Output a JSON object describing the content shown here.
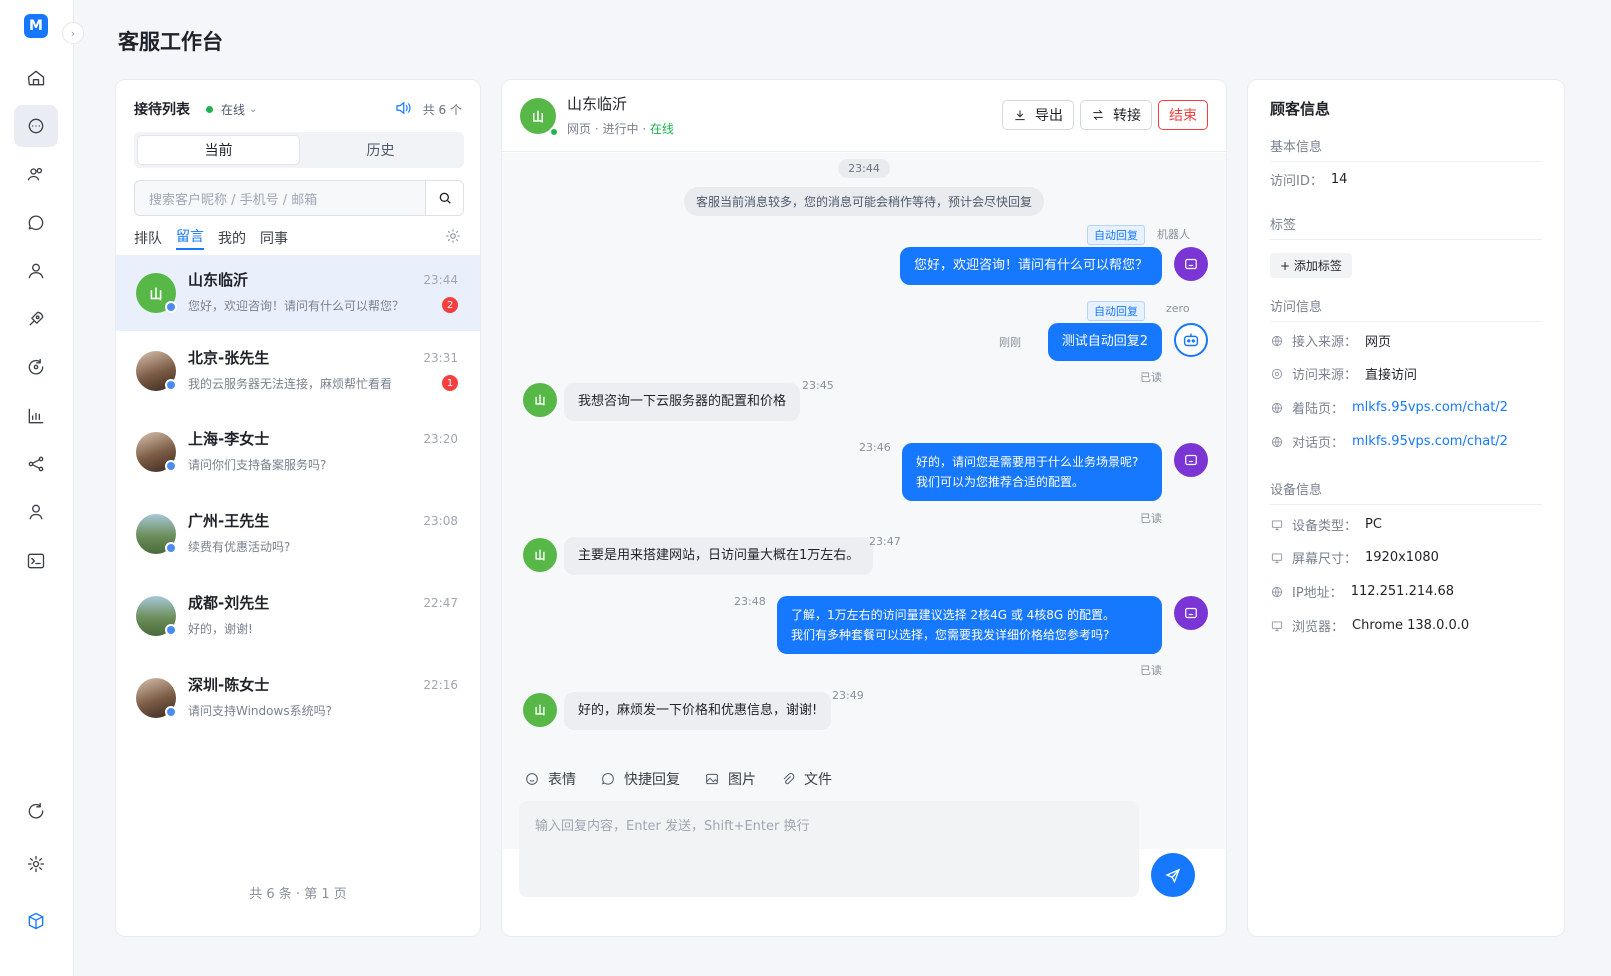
{
  "page_title": "客服工作台",
  "rail": {
    "logo": "M",
    "items": [
      "home-icon",
      "chat-icon",
      "users-icon",
      "message-icon",
      "user-icon",
      "rocket-icon",
      "sync-icon",
      "chart-icon",
      "share-icon",
      "person-icon",
      "terminal-icon",
      "refresh-icon",
      "settings-icon",
      "box-icon"
    ]
  },
  "list": {
    "title": "接待列表",
    "status": "在线",
    "count": "共 6 个",
    "tabs": [
      "当前",
      "历史"
    ],
    "search_placeholder": "搜索客户昵称 / 手机号 / 邮箱",
    "filters": [
      "排队",
      "留言",
      "我的",
      "同事"
    ],
    "conversations": [
      {
        "name": "山东临沂",
        "time": "23:44",
        "message": "您好，欢迎咨询！请问有什么可以帮您？",
        "unread": "2",
        "avatar": "山"
      },
      {
        "name": "北京-张先生",
        "time": "23:31",
        "message": "我的云服务器无法连接，麻烦帮忙看看",
        "unread": "1",
        "avatar": ""
      },
      {
        "name": "上海-李女士",
        "time": "23:20",
        "message": "请问你们支持备案服务吗?",
        "unread": "",
        "avatar": ""
      },
      {
        "name": "广州-王先生",
        "time": "23:08",
        "message": "续费有优惠活动吗?",
        "unread": "",
        "avatar": ""
      },
      {
        "name": "成都-刘先生",
        "time": "22:47",
        "message": "好的，谢谢!",
        "unread": "",
        "avatar": ""
      },
      {
        "name": "深圳-陈女士",
        "time": "22:16",
        "message": "请问支持Windows系统吗?",
        "unread": "",
        "avatar": ""
      }
    ],
    "footer": "共 6 条 · 第 1 页"
  },
  "chat": {
    "name": "山东临沂",
    "avatar": "山",
    "sub_prefix": "网页 · 进行中 · ",
    "sub_status": "在线",
    "buttons": {
      "export": "导出",
      "transfer": "转接",
      "end": "结束"
    },
    "time_pill": "23:44",
    "system_notice": "客服当前消息较多，您的消息可能会稍作等待，预计会尽快回复",
    "messages": {
      "m1_tag": "自动回复",
      "m1_sender": "机器人",
      "m1_text": "您好，欢迎咨询！请问有什么可以帮您？",
      "m2_tag": "自动回复",
      "m2_sender": "zero",
      "m2_time": "刚刚",
      "m2_text": "测试自动回复2",
      "m2_read": "已读",
      "m3_text": "我想咨询一下云服务器的配置和价格",
      "m3_time": "23:45",
      "m4_time": "23:46",
      "m4_line1": "好的，请问您是需要用于什么业务场景呢?",
      "m4_line2": "我们可以为您推荐合适的配置。",
      "m4_read": "已读",
      "m5_text": "主要是用来搭建网站，日访问量大概在1万左右。",
      "m5_time": "23:47",
      "m6_time": "23:48",
      "m6_line1": "了解，1万左右的访问量建议选择 2核4G 或 4核8G 的配置。",
      "m6_line2": "我们有多种套餐可以选择，您需要我发详细价格给您参考吗?",
      "m6_read": "已读",
      "m7_text": "好的，麻烦发一下价格和优惠信息，谢谢!",
      "m7_time": "23:49"
    },
    "toolbar": [
      "表情",
      "快捷回复",
      "图片",
      "文件"
    ],
    "compose_placeholder": "输入回复内容，Enter 发送，Shift+Enter 换行"
  },
  "info": {
    "title": "顾客信息",
    "basic": "基本信息",
    "visitor_id_label": "访问ID：",
    "visitor_id": "14",
    "tags": "标签",
    "add_tag": "+ 添加标签",
    "visit": "访问信息",
    "entry_label": "接入来源：",
    "entry": "网页",
    "referrer_label": "访问来源：",
    "referrer": "直接访问",
    "landing_label": "着陆页：",
    "landing": "mlkfs.95vps.com/chat/2",
    "chat_label": "对话页：",
    "chat_page": "mlkfs.95vps.com/chat/2",
    "device": "设备信息",
    "device_type_label": "设备类型：",
    "device_type": "PC",
    "screen_label": "屏幕尺寸：",
    "screen": "1920x1080",
    "ip_label": "IP地址：",
    "ip": "112.251.214.68",
    "browser_label": "浏览器：",
    "browser": "Chrome 138.0.0.0"
  },
  "colors": {
    "accent": "#1677ff",
    "online": "#1fb34d",
    "danger": "#f53f3f"
  }
}
